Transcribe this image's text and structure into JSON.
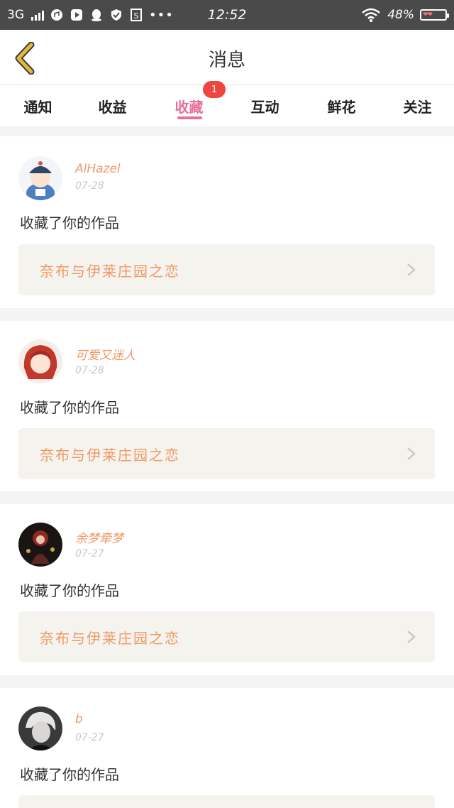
{
  "status_bar": {
    "network": "3G",
    "time": "12:52",
    "battery": "48%"
  },
  "header": {
    "title": "消息"
  },
  "tabs": [
    {
      "label": "通知"
    },
    {
      "label": "收益"
    },
    {
      "label": "收藏",
      "badge": "1",
      "active": true
    },
    {
      "label": "互动"
    },
    {
      "label": "鲜花"
    },
    {
      "label": "关注"
    }
  ],
  "messages": [
    {
      "user": "AlHazel",
      "date": "07-28",
      "action": "收藏了你的作品",
      "work": "奈布与伊莱庄园之恋"
    },
    {
      "user": "可爱又迷人",
      "date": "07-28",
      "action": "收藏了你的作品",
      "work": "奈布与伊莱庄园之恋"
    },
    {
      "user": "余梦牵梦",
      "date": "07-27",
      "action": "收藏了你的作品",
      "work": "奈布与伊莱庄园之恋"
    },
    {
      "user": "b",
      "date": "07-27",
      "action": "收藏了你的作品"
    }
  ],
  "colors": {
    "accent": "#e8709a",
    "username": "#ee9a6a",
    "work_title": "#ef9a64",
    "badge": "#f0443e",
    "back_arrow": "#e3b93a"
  }
}
